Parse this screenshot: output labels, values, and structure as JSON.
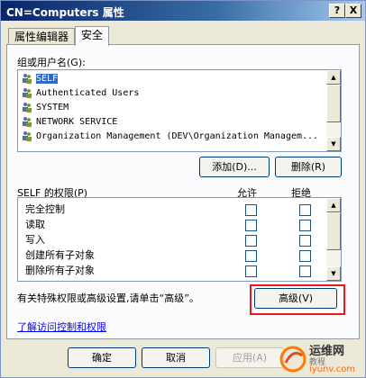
{
  "window": {
    "title": "CN=Computers 属性",
    "help_btn": "?",
    "close_btn": "X"
  },
  "tabs": [
    {
      "label": "属性编辑器"
    },
    {
      "label": "安全"
    }
  ],
  "groups": {
    "label": "组或用户名(G):",
    "items": [
      {
        "label": "SELF",
        "selected": true
      },
      {
        "label": "Authenticated Users"
      },
      {
        "label": "SYSTEM"
      },
      {
        "label": "NETWORK SERVICE"
      },
      {
        "label": "Organization Management (DEV\\Organization Managem..."
      }
    ],
    "add_btn": "添加(D)...",
    "remove_btn": "删除(R)"
  },
  "permissions": {
    "label": "SELF 的权限(P)",
    "allow_header": "允许",
    "deny_header": "拒绝",
    "rows": [
      {
        "name": "完全控制"
      },
      {
        "name": "读取"
      },
      {
        "name": "写入"
      },
      {
        "name": "创建所有子对象"
      },
      {
        "name": "删除所有子对象"
      }
    ]
  },
  "advanced": {
    "note": "有关特殊权限或高级设置,请单击“高级”。",
    "button": "高级(V)"
  },
  "link": {
    "text": "了解访问控制和权限"
  },
  "footer": {
    "ok": "确定",
    "cancel": "取消",
    "apply": "应用(A)"
  },
  "watermark": {
    "text": "运维网",
    "sub": "教程",
    "domain": "iyunv.com"
  },
  "colors": {
    "selection": "#316ac5",
    "highlight_border": "#e81818",
    "link": "#0000ff"
  }
}
